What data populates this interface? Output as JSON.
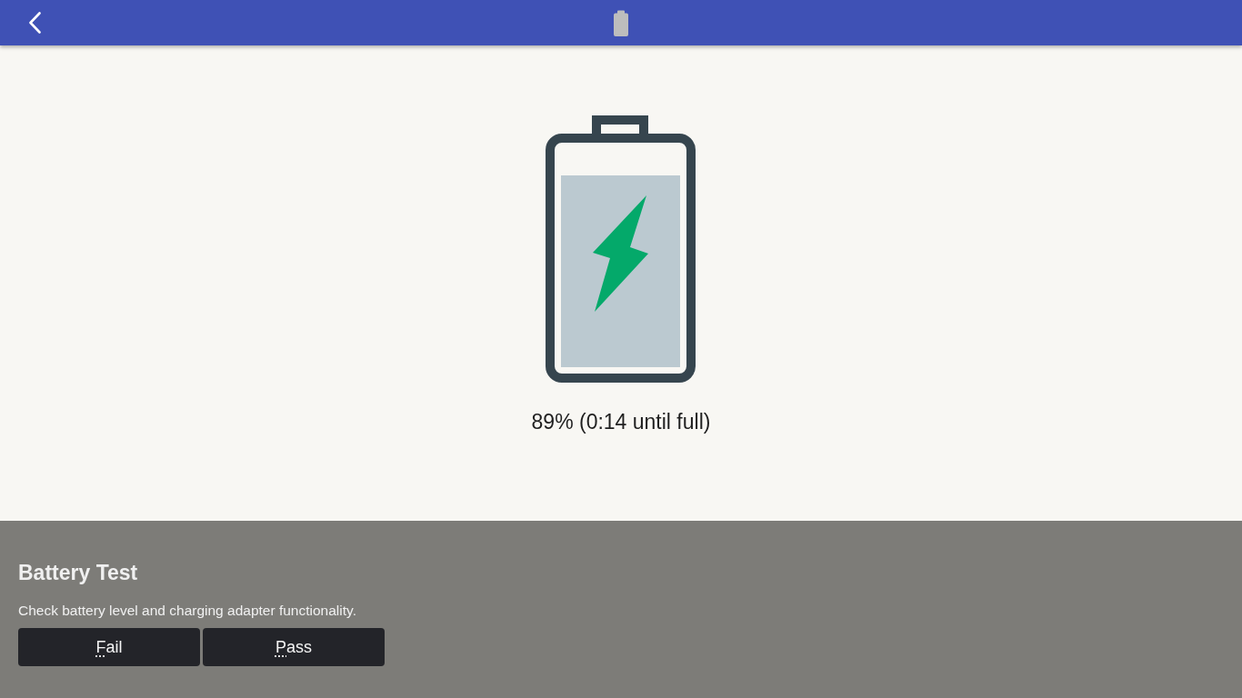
{
  "battery": {
    "charging": true,
    "reading": "89% (0:14 until full)"
  },
  "test": {
    "title": "Battery Test",
    "description": "Check battery level and charging adapter functionality.",
    "buttons": [
      "Fail",
      "Pass"
    ]
  }
}
